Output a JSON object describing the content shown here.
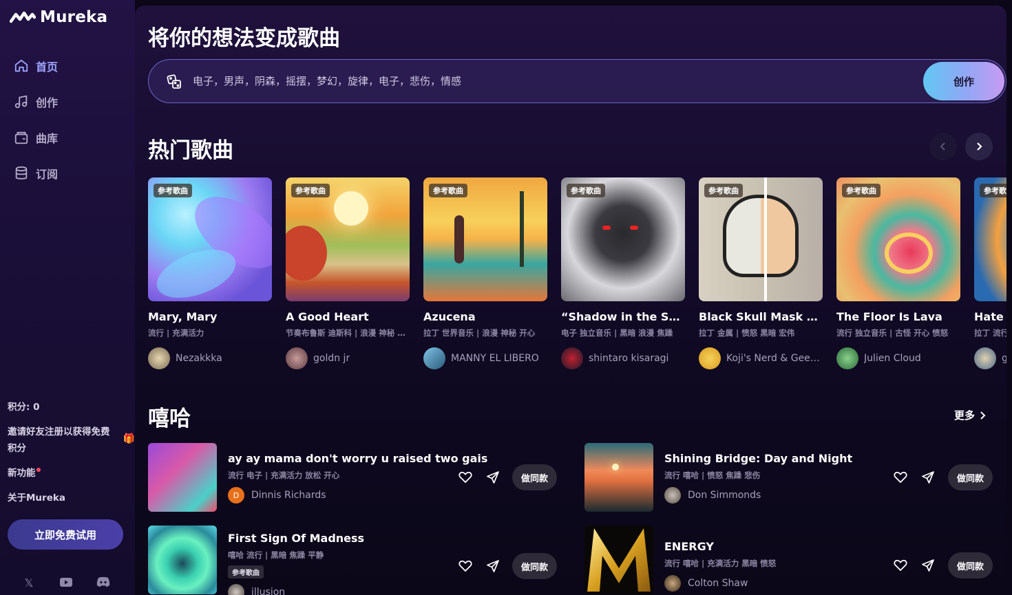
{
  "app": {
    "name": "Mureka"
  },
  "sidebar": {
    "nav": [
      {
        "label": "首页",
        "icon": "home-icon",
        "active": true
      },
      {
        "label": "创作",
        "icon": "music-note-icon",
        "active": false
      },
      {
        "label": "曲库",
        "icon": "library-icon",
        "active": false
      },
      {
        "label": "订阅",
        "icon": "database-icon",
        "active": false
      }
    ],
    "credits": "积分: 0",
    "invite": "邀请好友注册以获得免费积分",
    "new_features": "新功能",
    "about": "关于Mureka",
    "try_free": "立即免费试用"
  },
  "hero": {
    "title": "将你的想法变成歌曲",
    "prompt": "电子，男声，阴森，摇摆，梦幻，旋律，电子，悲伤，情感",
    "create_label": "创作"
  },
  "hot": {
    "title": "热门歌曲",
    "tag": "参考歌曲",
    "cards": [
      {
        "title": "Mary, Mary",
        "genre": "流行 | 充满活力",
        "author": "Nezakkka"
      },
      {
        "title": "A Good Heart",
        "genre": "节奏布鲁斯 迪斯科 | 浪漫 神秘 开心",
        "author": "goldn jr"
      },
      {
        "title": "Azucena",
        "genre": "拉丁 世界音乐 | 浪漫 神秘 开心",
        "author": "MANNY EL LIBERO"
      },
      {
        "title": "“Shadow in the Shadows”",
        "genre": "电子 独立音乐 | 黑暗 浪漫 焦躁",
        "author": "shintaro kisaragi"
      },
      {
        "title": "Black Skull Mask THE HERO",
        "genre": "拉丁 金属 | 愤怒 黑暗 宏伟",
        "author": "Koji's Nerd & Geek Shop"
      },
      {
        "title": "The Floor Is Lava",
        "genre": "流行 独立音乐 | 古怪 开心 愤怒",
        "author": "Julien Cloud"
      },
      {
        "title": "Hate You",
        "genre": "拉丁 流行",
        "author": "g"
      }
    ]
  },
  "hiphop": {
    "title": "嘻哈",
    "more_label": "更多",
    "copy_label": "做同款",
    "ref_tag": "参考歌曲",
    "rows": [
      {
        "title": "ay ay mama don't worry u raised two gais",
        "genre": "流行 电子 | 充满活力 放松 开心",
        "author": "Dinnis Richards",
        "initial": "D"
      },
      {
        "title": "Shining Bridge: Day and Night",
        "genre": "流行 嘻哈 | 愤怒 焦躁 悲伤",
        "author": "Don Simmonds"
      },
      {
        "title": "First Sign Of Madness",
        "genre": "嘻哈 流行 | 黑暗 焦躁 平静",
        "author": "illusion"
      },
      {
        "title": "ENERGY",
        "genre": "流行 嘻哈 | 充满活力 黑暗 愤怒",
        "author": "Colton Shaw"
      }
    ]
  }
}
